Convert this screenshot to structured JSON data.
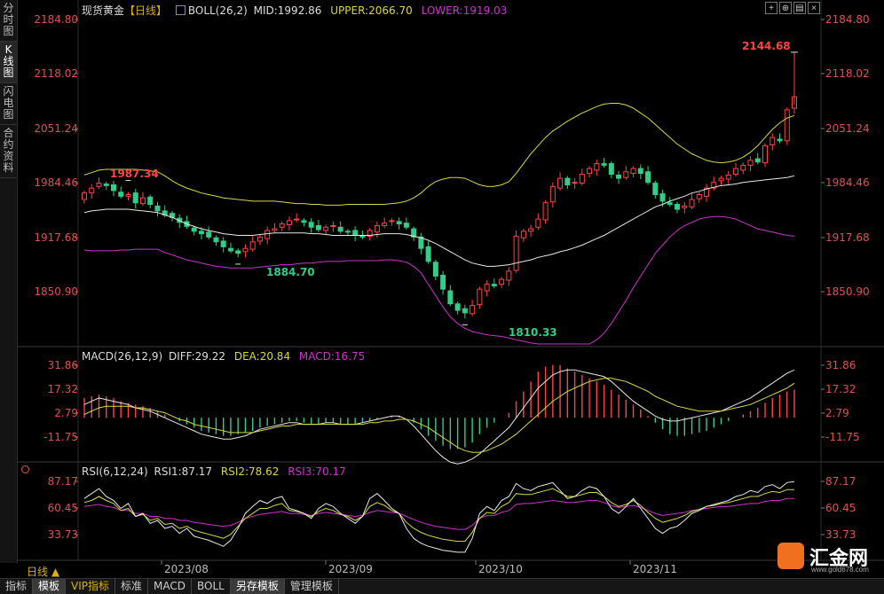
{
  "sidebar": {
    "tabs": [
      {
        "label": "分时图",
        "active": false
      },
      {
        "label": "K线图",
        "active": true
      },
      {
        "label": "闪电图",
        "active": false
      },
      {
        "label": "合约资料",
        "active": false
      }
    ]
  },
  "main_chart": {
    "legend": {
      "title": "现货黄金",
      "period_tag": "【日线】",
      "indicator": "BOLL(26,2)",
      "mid": "MID:1992.86",
      "upper": "UPPER:2066.70",
      "lower": "LOWER:1919.03"
    },
    "y_ticks": [
      "2184.80",
      "2118.02",
      "2051.24",
      "1984.46",
      "1917.68",
      "1850.90"
    ],
    "annotations": {
      "high": "2144.68",
      "peak_early": "1987.34",
      "low_mid": "1884.70",
      "low": "1810.33"
    }
  },
  "macd_panel": {
    "legend": {
      "indicator": "MACD(26,12,9)",
      "diff": "DIFF:29.22",
      "dea": "DEA:20.84",
      "macd": "MACD:16.75"
    },
    "y_ticks": [
      "31.86",
      "17.32",
      "2.79",
      "-11.75"
    ]
  },
  "rsi_panel": {
    "legend": {
      "indicator": "RSI(6,12,24)",
      "rsi1": "RSI1:87.17",
      "rsi2": "RSI2:78.62",
      "rsi3": "RSI3:70.17"
    },
    "y_ticks": [
      "87.17",
      "60.45",
      "33.73"
    ]
  },
  "x_axis": {
    "dates": [
      "2023/08",
      "2023/09",
      "2023/10",
      "2023/11"
    ],
    "period_label": "日线 ▲"
  },
  "bottom_tabs": [
    {
      "label": "指标",
      "active": false
    },
    {
      "label": "模板",
      "active": true
    },
    {
      "label": "VIP指标",
      "active": false,
      "vip": true
    },
    {
      "label": "标准",
      "active": false
    },
    {
      "label": "MACD",
      "active": false
    },
    {
      "label": "BOLL",
      "active": false
    },
    {
      "label": "另存模板",
      "active": true
    },
    {
      "label": "管理模板",
      "active": false
    }
  ],
  "toolbar_icons": [
    "cross-icon",
    "crosshair-icon",
    "layout-icon",
    "close-icon"
  ],
  "logo": {
    "text": "汇金网",
    "url": "www.gold678.com"
  },
  "colors": {
    "up": "#ff4444",
    "down": "#33cc88",
    "mid": "#e8e8e8",
    "upper": "#d8d840",
    "lower": "#cc33cc",
    "axis_text": "#e05050",
    "rsi1": "#e8e8e8",
    "rsi2": "#d8d840",
    "rsi3": "#cc33cc"
  },
  "chart_data": {
    "type": "candlestick",
    "price_range": [
      1784,
      2200
    ],
    "series": {
      "close": [
        1972,
        1978,
        1984,
        1981,
        1975,
        1968,
        1970,
        1960,
        1966,
        1958,
        1950,
        1945,
        1942,
        1936,
        1931,
        1925,
        1922,
        1918,
        1912,
        1906,
        1901,
        1898,
        1904,
        1912,
        1918,
        1926,
        1928,
        1934,
        1938,
        1940,
        1936,
        1930,
        1927,
        1930,
        1932,
        1925,
        1924,
        1920,
        1918,
        1926,
        1932,
        1935,
        1938,
        1934,
        1930,
        1918,
        1904,
        1888,
        1870,
        1854,
        1836,
        1828,
        1825,
        1834,
        1854,
        1860,
        1858,
        1866,
        1876,
        1919,
        1925,
        1928,
        1940,
        1960,
        1980,
        1990,
        1982,
        1985,
        1995,
        2002,
        2008,
        2006,
        1995,
        1990,
        1998,
        2002,
        1996,
        1985,
        1970,
        1962,
        1958,
        1952,
        1956,
        1964,
        1970,
        1978,
        1985,
        1990,
        1994,
        2002,
        2006,
        2012,
        2010,
        2030,
        2040,
        2036,
        2074,
        2090
      ],
      "mid": [
        1948,
        1950,
        1951,
        1952,
        1952,
        1952,
        1952,
        1951,
        1950,
        1949,
        1948,
        1945,
        1942,
        1938,
        1934,
        1931,
        1928,
        1926,
        1924,
        1922,
        1921,
        1920,
        1920,
        1920,
        1921,
        1922,
        1923,
        1923,
        1923,
        1923,
        1923,
        1922,
        1922,
        1921,
        1920,
        1920,
        1920,
        1920,
        1920,
        1920,
        1921,
        1922,
        1922,
        1922,
        1921,
        1919,
        1917,
        1914,
        1910,
        1905,
        1900,
        1895,
        1890,
        1886,
        1884,
        1882,
        1882,
        1883,
        1884,
        1886,
        1888,
        1890,
        1893,
        1895,
        1897,
        1900,
        1902,
        1905,
        1908,
        1912,
        1916,
        1920,
        1925,
        1930,
        1935,
        1940,
        1945,
        1950,
        1955,
        1958,
        1962,
        1965,
        1968,
        1972,
        1974,
        1977,
        1979,
        1981,
        1982,
        1983,
        1985,
        1986,
        1987,
        1988,
        1989,
        1990,
        1991,
        1993
      ],
      "upper": [
        1994,
        1997,
        2000,
        2001,
        2001,
        2001,
        2001,
        2001,
        2000,
        1999,
        1998,
        1993,
        1987,
        1982,
        1978,
        1975,
        1972,
        1970,
        1968,
        1966,
        1965,
        1964,
        1963,
        1962,
        1962,
        1962,
        1962,
        1961,
        1960,
        1959,
        1959,
        1958,
        1958,
        1957,
        1957,
        1957,
        1958,
        1958,
        1958,
        1958,
        1958,
        1958,
        1959,
        1960,
        1962,
        1966,
        1972,
        1980,
        1986,
        1989,
        1991,
        1991,
        1990,
        1986,
        1982,
        1980,
        1980,
        1982,
        1986,
        1996,
        2008,
        2020,
        2030,
        2040,
        2048,
        2054,
        2060,
        2065,
        2070,
        2074,
        2078,
        2081,
        2082,
        2082,
        2080,
        2076,
        2070,
        2064,
        2056,
        2048,
        2040,
        2032,
        2026,
        2020,
        2016,
        2012,
        2010,
        2009,
        2010,
        2012,
        2016,
        2022,
        2030,
        2040,
        2050,
        2058,
        2064,
        2067
      ],
      "lower": [
        1902,
        1901,
        1901,
        1901,
        1901,
        1902,
        1902,
        1903,
        1903,
        1903,
        1903,
        1899,
        1896,
        1893,
        1890,
        1888,
        1886,
        1884,
        1882,
        1881,
        1880,
        1880,
        1880,
        1880,
        1881,
        1882,
        1883,
        1884,
        1884,
        1885,
        1886,
        1886,
        1887,
        1888,
        1888,
        1888,
        1889,
        1889,
        1889,
        1889,
        1889,
        1890,
        1890,
        1889,
        1887,
        1882,
        1874,
        1860,
        1846,
        1832,
        1820,
        1812,
        1806,
        1802,
        1800,
        1798,
        1797,
        1796,
        1794,
        1792,
        1790,
        1788,
        1786,
        1784,
        1782,
        1780,
        1780,
        1780,
        1782,
        1786,
        1792,
        1800,
        1812,
        1826,
        1840,
        1856,
        1870,
        1884,
        1898,
        1908,
        1918,
        1926,
        1932,
        1936,
        1940,
        1942,
        1943,
        1943,
        1942,
        1940,
        1936,
        1932,
        1928,
        1926,
        1924,
        1922,
        1920,
        1919
      ],
      "macd_hist": [
        12,
        13,
        14,
        13,
        12,
        10,
        9,
        8,
        7,
        6,
        4,
        2,
        0,
        -2,
        -4,
        -6,
        -8,
        -9,
        -10,
        -11,
        -11,
        -10,
        -9,
        -8,
        -6,
        -5,
        -4,
        -3,
        -2,
        -2,
        -3,
        -4,
        -4,
        -3,
        -3,
        -4,
        -4,
        -4,
        -3,
        -2,
        -1,
        0,
        1,
        1,
        0,
        -3,
        -7,
        -11,
        -14,
        -17,
        -19,
        -19,
        -18,
        -15,
        -10,
        -6,
        -3,
        0,
        3,
        10,
        16,
        22,
        28,
        31,
        32,
        32,
        30,
        28,
        26,
        24,
        22,
        20,
        17,
        14,
        11,
        8,
        5,
        1,
        -3,
        -7,
        -10,
        -11,
        -11,
        -10,
        -9,
        -8,
        -6,
        -4,
        -2,
        0,
        2,
        4,
        6,
        9,
        12,
        14,
        16,
        17
      ],
      "diff": [
        8,
        10,
        12,
        11,
        10,
        9,
        8,
        6,
        5,
        4,
        2,
        0,
        -2,
        -4,
        -6,
        -8,
        -10,
        -11,
        -12,
        -13,
        -13,
        -12,
        -11,
        -9,
        -7,
        -6,
        -5,
        -4,
        -3,
        -3,
        -4,
        -4,
        -4,
        -3,
        -3,
        -4,
        -4,
        -4,
        -3,
        -2,
        -1,
        0,
        1,
        1,
        -1,
        -5,
        -10,
        -15,
        -20,
        -24,
        -27,
        -28,
        -27,
        -25,
        -22,
        -18,
        -14,
        -10,
        -6,
        0,
        6,
        12,
        18,
        22,
        26,
        28,
        29,
        29,
        28,
        27,
        26,
        25,
        22,
        18,
        14,
        10,
        7,
        4,
        1,
        -1,
        -2,
        -2,
        -1,
        0,
        1,
        2,
        3,
        4,
        6,
        8,
        10,
        12,
        15,
        18,
        21,
        24,
        27,
        29
      ],
      "dea": [
        2,
        4,
        6,
        7,
        7,
        7,
        7,
        6,
        6,
        5,
        4,
        3,
        1,
        -1,
        -2,
        -4,
        -5,
        -6,
        -7,
        -8,
        -9,
        -9,
        -9,
        -9,
        -8,
        -7,
        -6,
        -5,
        -5,
        -4,
        -4,
        -4,
        -4,
        -4,
        -4,
        -4,
        -4,
        -4,
        -4,
        -3,
        -3,
        -2,
        -2,
        -1,
        -1,
        -2,
        -4,
        -6,
        -9,
        -12,
        -15,
        -18,
        -20,
        -21,
        -21,
        -20,
        -18,
        -16,
        -13,
        -10,
        -6,
        -2,
        2,
        6,
        10,
        13,
        16,
        18,
        20,
        22,
        23,
        24,
        24,
        23,
        22,
        20,
        18,
        16,
        13,
        11,
        9,
        7,
        6,
        5,
        4,
        4,
        4,
        4,
        5,
        6,
        7,
        8,
        10,
        12,
        14,
        16,
        18,
        21
      ],
      "rsi1": [
        70,
        75,
        80,
        72,
        68,
        60,
        65,
        52,
        55,
        45,
        48,
        40,
        42,
        35,
        40,
        32,
        30,
        28,
        25,
        22,
        28,
        40,
        55,
        62,
        68,
        65,
        70,
        72,
        60,
        58,
        55,
        50,
        60,
        65,
        62,
        55,
        50,
        45,
        52,
        70,
        75,
        68,
        60,
        55,
        40,
        30,
        25,
        22,
        20,
        18,
        17,
        16,
        16,
        30,
        55,
        62,
        58,
        68,
        72,
        85,
        80,
        78,
        82,
        84,
        86,
        78,
        70,
        72,
        78,
        82,
        80,
        72,
        60,
        55,
        62,
        70,
        60,
        50,
        40,
        35,
        40,
        42,
        48,
        55,
        58,
        62,
        64,
        66,
        68,
        72,
        74,
        78,
        76,
        82,
        84,
        80,
        86,
        87
      ],
      "rsi2": [
        66,
        68,
        72,
        68,
        65,
        58,
        60,
        52,
        54,
        48,
        50,
        44,
        45,
        40,
        42,
        38,
        36,
        34,
        32,
        30,
        34,
        42,
        50,
        55,
        60,
        60,
        63,
        65,
        58,
        57,
        55,
        52,
        57,
        60,
        58,
        54,
        52,
        48,
        52,
        62,
        66,
        63,
        58,
        55,
        46,
        40,
        36,
        33,
        31,
        29,
        28,
        27,
        27,
        36,
        50,
        56,
        55,
        62,
        66,
        75,
        74,
        74,
        76,
        78,
        80,
        76,
        72,
        72,
        74,
        76,
        76,
        72,
        66,
        62,
        64,
        68,
        63,
        56,
        50,
        46,
        48,
        50,
        53,
        57,
        59,
        62,
        63,
        65,
        66,
        68,
        70,
        72,
        72,
        75,
        77,
        76,
        79,
        79
      ],
      "rsi3": [
        62,
        63,
        64,
        62,
        61,
        58,
        58,
        55,
        55,
        52,
        52,
        50,
        50,
        48,
        48,
        46,
        45,
        44,
        43,
        42,
        43,
        46,
        50,
        52,
        54,
        55,
        56,
        57,
        55,
        55,
        54,
        53,
        55,
        56,
        55,
        54,
        53,
        52,
        53,
        56,
        58,
        57,
        56,
        55,
        52,
        49,
        46,
        44,
        42,
        41,
        40,
        39,
        39,
        43,
        50,
        53,
        53,
        56,
        58,
        64,
        65,
        65,
        66,
        67,
        68,
        67,
        66,
        66,
        67,
        68,
        68,
        66,
        63,
        61,
        62,
        63,
        61,
        58,
        55,
        53,
        54,
        55,
        56,
        58,
        59,
        60,
        61,
        62,
        62,
        63,
        64,
        65,
        65,
        67,
        68,
        68,
        70,
        70
      ]
    }
  }
}
